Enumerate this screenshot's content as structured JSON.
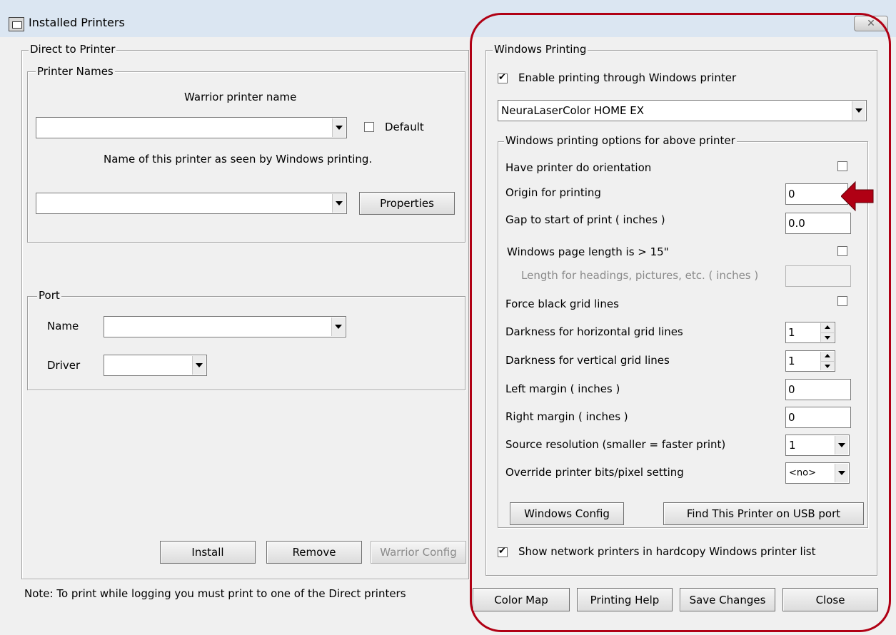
{
  "window": {
    "title": "Installed Printers",
    "close_glyph": "✕"
  },
  "direct": {
    "legend": "Direct to Printer",
    "printer_names": {
      "legend": "Printer Names",
      "warrior_label": "Warrior printer name",
      "warrior_value": "",
      "default_label": "Default",
      "default_checked": false,
      "windows_label": "Name of this printer as seen by Windows printing.",
      "windows_value": "",
      "properties_label": "Properties"
    },
    "port": {
      "legend": "Port",
      "name_label": "Name",
      "name_value": "",
      "driver_label": "Driver",
      "driver_value": ""
    },
    "install_label": "Install",
    "remove_label": "Remove",
    "warrior_config_label": "Warrior Config"
  },
  "note": "Note:  To print while logging you must print to one of the Direct printers",
  "windows": {
    "legend": "Windows Printing",
    "enable_label": "Enable printing through Windows printer",
    "enable_checked": true,
    "printer_value": "NeuraLaserColor HOME EX",
    "options": {
      "legend": "Windows printing options for above printer",
      "orientation_label": "Have printer do orientation",
      "orientation_checked": false,
      "origin_label": "Origin for printing",
      "origin_value": "0",
      "gap_label": "Gap to start of print ( inches )",
      "gap_value": "0.0",
      "page_length_label": "Windows page length is > 15\"",
      "page_length_checked": false,
      "headings_length_label": "Length for headings, pictures, etc. ( inches )",
      "headings_length_value": "",
      "black_grid_label": "Force black grid lines",
      "black_grid_checked": false,
      "dark_h_label": "Darkness for horizontal grid lines",
      "dark_h_value": "1",
      "dark_v_label": "Darkness for vertical grid lines",
      "dark_v_value": "1",
      "left_margin_label": "Left margin ( inches )",
      "left_margin_value": "0",
      "right_margin_label": "Right margin ( inches )",
      "right_margin_value": "0",
      "source_res_label": "Source resolution (smaller = faster print)",
      "source_res_value": "1",
      "override_bits_label": "Override printer bits/pixel setting",
      "override_bits_value": "<no>",
      "windows_config_label": "Windows Config",
      "find_usb_label": "Find This Printer on USB port"
    },
    "show_network_label": "Show network printers in hardcopy Windows printer list",
    "show_network_checked": true
  },
  "footer": {
    "color_map_label": "Color Map",
    "printing_help_label": "Printing Help",
    "save_changes_label": "Save Changes",
    "close_label": "Close"
  },
  "annotation": {
    "highlight_color": "#b00014",
    "arrow_color": "#b00014"
  }
}
